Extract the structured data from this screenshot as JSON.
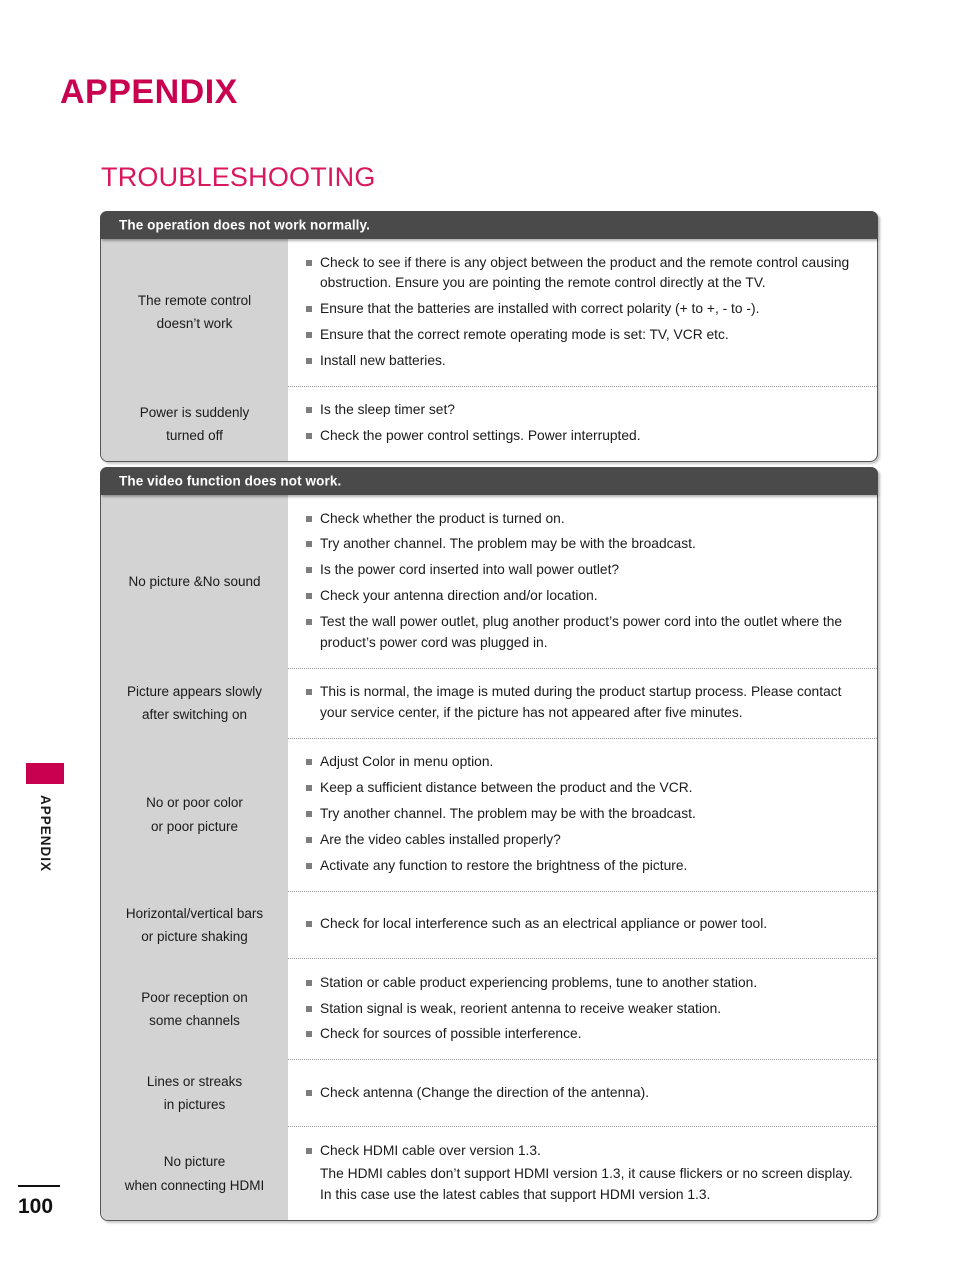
{
  "page": {
    "title": "APPENDIX",
    "section_title": "TROUBLESHOOTING",
    "side_label": "APPENDIX",
    "page_number": "100",
    "accent_color": "#C8004F",
    "header_bar_color": "#4A4A4A",
    "label_cell_color": "#D3D3D3"
  },
  "tables": [
    {
      "header": "The operation does not work normally.",
      "rows": [
        {
          "label": "The remote control\ndoesn't work",
          "label_lines": [
            "The remote control",
            "doesn’t work"
          ],
          "items": [
            {
              "text": "Check to see if there is any object between the product and the remote control causing obstruction. Ensure you are pointing the remote control directly at the TV.",
              "bullet": true
            },
            {
              "text": "Ensure that the batteries are installed with correct polarity (+ to +, - to -).",
              "bullet": true
            },
            {
              "text": "Ensure that the correct remote operating mode is set: TV, VCR etc.",
              "bullet": true
            },
            {
              "text": "Install new batteries.",
              "bullet": true
            }
          ]
        },
        {
          "label": "Power is suddenly\nturned off",
          "label_lines": [
            "Power is suddenly",
            "turned off"
          ],
          "items": [
            {
              "text": "Is the sleep timer set?",
              "bullet": true
            },
            {
              "text": "Check the power control settings. Power interrupted.",
              "bullet": true
            }
          ]
        }
      ]
    },
    {
      "header": "The video function does not work.",
      "rows": [
        {
          "label": "No picture &No sound",
          "label_lines": [
            "No picture &No sound"
          ],
          "items": [
            {
              "text": "Check whether the product is turned on.",
              "bullet": true
            },
            {
              "text": "Try another channel. The problem may be with the broadcast.",
              "bullet": true
            },
            {
              "text": "Is the power cord inserted into wall power outlet?",
              "bullet": true
            },
            {
              "text": "Check your antenna direction and/or location.",
              "bullet": true
            },
            {
              "text": "Test the wall power outlet, plug another product’s power cord into the outlet where the product’s power cord was plugged in.",
              "bullet": true
            }
          ]
        },
        {
          "label": "Picture appears slowly\nafter switching on",
          "label_lines": [
            "Picture appears slowly",
            "after switching on"
          ],
          "items": [
            {
              "text": "This is normal, the image is muted during the product startup process. Please contact your service center, if the picture has not appeared after five minutes.",
              "bullet": true
            }
          ]
        },
        {
          "label": "No or poor color\nor poor picture",
          "label_lines": [
            "No or poor color",
            "or poor picture"
          ],
          "items": [
            {
              "text": "Adjust Color in menu option.",
              "bullet": true
            },
            {
              "text": "Keep a sufficient distance between the product and the VCR.",
              "bullet": true
            },
            {
              "text": "Try another channel. The problem may be with the broadcast.",
              "bullet": true
            },
            {
              "text": "Are the video cables installed properly?",
              "bullet": true
            },
            {
              "text": "Activate any function to restore the brightness of the picture.",
              "bullet": true
            }
          ]
        },
        {
          "label": "Horizontal/vertical bars\nor picture shaking",
          "label_lines": [
            "Horizontal/vertical bars",
            "or picture shaking"
          ],
          "items": [
            {
              "text": "Check for local interference such as an electrical appliance or power tool.",
              "bullet": true
            }
          ]
        },
        {
          "label": "Poor reception on\nsome channels",
          "label_lines": [
            "Poor reception on",
            "some channels"
          ],
          "items": [
            {
              "text": "Station or cable product experiencing problems, tune to another station.",
              "bullet": true
            },
            {
              "text": "Station signal is weak, reorient antenna to receive weaker station.",
              "bullet": true
            },
            {
              "text": "Check for sources of possible interference.",
              "bullet": true
            }
          ]
        },
        {
          "label": "Lines or streaks\nin pictures",
          "label_lines": [
            "Lines or streaks",
            "in pictures"
          ],
          "items": [
            {
              "text": "Check antenna (Change the direction of the antenna).",
              "bullet": true
            }
          ]
        },
        {
          "label": "No picture\nwhen connecting HDMI",
          "label_lines": [
            "No picture",
            "when connecting HDMI"
          ],
          "items": [
            {
              "text": "Check HDMI cable over version 1.3.",
              "bullet": true
            },
            {
              "text": "The HDMI cables don’t support HDMI version 1.3, it cause flickers or no screen display. In this case use the latest cables that support HDMI version 1.3.",
              "bullet": false
            }
          ]
        }
      ]
    }
  ]
}
